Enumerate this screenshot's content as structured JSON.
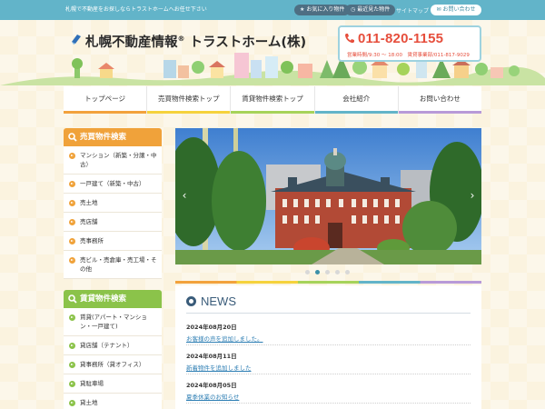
{
  "topbar": {
    "tagline": "札幌で不動産をお探しならトラストホームへお任せ下さい",
    "favorites_label": "お気に入り物件",
    "recent_label": "最近見た物件",
    "sitemap_label": "サイトマップ",
    "contact_label": "お問い合わせ"
  },
  "header": {
    "logo_text": "札幌不動産情報",
    "logo_reg": "®",
    "logo_company": " トラストホーム(株)",
    "phone": "011-820-1155",
    "hours": "営業時間/9:30 ～ 18:00　賃貸事業部/011-817-9029"
  },
  "nav": {
    "items": [
      "トップページ",
      "売買物件検索トップ",
      "賃貸物件検索トップ",
      "会社紹介",
      "お問い合わせ"
    ],
    "colors": [
      "#f2a23c",
      "#f5d23c",
      "#a6d35a",
      "#62b4c9",
      "#b89ad8"
    ]
  },
  "sidebar": {
    "sale": {
      "title": "売買物件検索",
      "color": "#f0a23a",
      "items": [
        "マンション（新築・分譲・中古）",
        "一戸建て（新築・中古）",
        "売土地",
        "売店舗",
        "売事務所",
        "売ビル・売倉庫・売工場・その他"
      ]
    },
    "rent": {
      "title": "賃貸物件検索",
      "color": "#8bc34a",
      "items": [
        "賃貸(アパート・マンション・一戸建て)",
        "貸店舗（テナント）",
        "貸事務所（貸オフィス）",
        "貸駐車場",
        "貸土地"
      ]
    }
  },
  "slider": {
    "prev_icon": "chevron-left-icon",
    "next_icon": "chevron-right-icon",
    "current_slide": 2,
    "slide_count": 5
  },
  "news": {
    "title": "NEWS",
    "items": [
      {
        "date": "2024年08月20日",
        "text": "お客様の声を追加しました。"
      },
      {
        "date": "2024年08月11日",
        "text": "新着物件を追加しました"
      },
      {
        "date": "2024年08月05日",
        "text": "夏季休業のお知らせ"
      }
    ]
  }
}
